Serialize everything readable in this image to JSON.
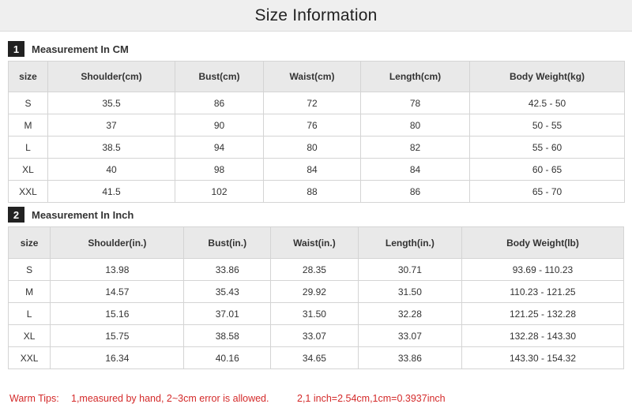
{
  "header": {
    "title": "Size Information"
  },
  "section_cm": {
    "number": "1",
    "title": "Measurement In CM",
    "columns": [
      "size",
      "Shoulder(cm)",
      "Bust(cm)",
      "Waist(cm)",
      "Length(cm)",
      "Body Weight(kg)"
    ],
    "rows": [
      [
        "S",
        "35.5",
        "86",
        "72",
        "78",
        "42.5 - 50"
      ],
      [
        "M",
        "37",
        "90",
        "76",
        "80",
        "50 - 55"
      ],
      [
        "L",
        "38.5",
        "94",
        "80",
        "82",
        "55 - 60"
      ],
      [
        "XL",
        "40",
        "98",
        "84",
        "84",
        "60 - 65"
      ],
      [
        "XXL",
        "41.5",
        "102",
        "88",
        "86",
        "65 - 70"
      ]
    ]
  },
  "section_inch": {
    "number": "2",
    "title": "Measurement In Inch",
    "columns": [
      "size",
      "Shoulder(in.)",
      "Bust(in.)",
      "Waist(in.)",
      "Length(in.)",
      "Body Weight(lb)"
    ],
    "rows": [
      [
        "S",
        "13.98",
        "33.86",
        "28.35",
        "30.71",
        "93.69 - 110.23"
      ],
      [
        "M",
        "14.57",
        "35.43",
        "29.92",
        "31.50",
        "110.23 - 121.25"
      ],
      [
        "L",
        "15.16",
        "37.01",
        "31.50",
        "32.28",
        "121.25 - 132.28"
      ],
      [
        "XL",
        "15.75",
        "38.58",
        "33.07",
        "33.07",
        "132.28 - 143.30"
      ],
      [
        "XXL",
        "16.34",
        "40.16",
        "34.65",
        "33.86",
        "143.30 - 154.32"
      ]
    ]
  },
  "tips": {
    "label": "Warm Tips:",
    "tip1": "1,measured by hand, 2~3cm error is allowed.",
    "tip2": "2,1 inch=2.54cm,1cm=0.3937inch"
  }
}
